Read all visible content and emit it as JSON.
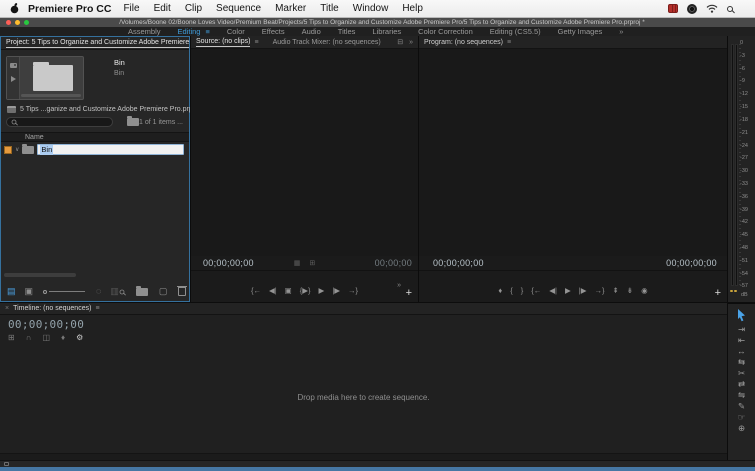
{
  "menu_bar": {
    "app_name": "Premiere Pro CC",
    "items": [
      "File",
      "Edit",
      "Clip",
      "Sequence",
      "Marker",
      "Title",
      "Window",
      "Help"
    ]
  },
  "title_bar": {
    "title": "/Volumes/Boone 02/Boone Loves Video/Premium Beat/Projects/5 Tips to Organize and Customize Adobe Premiere Pro/5 Tips to Organize and Customize Adobe Premiere Pro.prproj *"
  },
  "workspace": {
    "tabs": [
      "Assembly",
      "Editing",
      "Color",
      "Effects",
      "Audio",
      "Titles",
      "Libraries",
      "Color Correction",
      "Editing (CS5.5)",
      "Getty Images"
    ],
    "active_tab": "Editing",
    "menu_glyph": "≡",
    "overflow_glyph": "»"
  },
  "project": {
    "tab": "Project: 5 Tips to Organize and Customize Adobe Premiere",
    "overflow_glyph": "»",
    "item_name": "Bin",
    "item_type": "Bin",
    "file_label": "5 Tips ...ganize and Customize Adobe Premiere Pro.prproj",
    "count_label": "1 of 1 items ...",
    "name_column": "Name",
    "bin_value": "Bin",
    "chevron_glyph": "∨",
    "toolbar": {
      "list_glyph": "▤",
      "icon_glyph": "▣",
      "automate_glyph": "◌",
      "faint_glyph": "▥",
      "item_glyph": "▢"
    }
  },
  "source": {
    "tab": "Source: (no clips)",
    "menu_glyph": "≡",
    "tab2": "Audio Track Mixer: (no sequences)",
    "options_glyph": "⊟",
    "overflow_glyph": "»",
    "timecode": "00;00;00;00",
    "duration": "00;00;00",
    "mid_icons": [
      "▦",
      "⊞"
    ],
    "transport": [
      "{←",
      "◀|",
      "▣",
      "{▶}",
      "▶",
      "|▶",
      "→}"
    ],
    "plus_glyph": "+"
  },
  "program": {
    "tab": "Program: (no sequences)",
    "menu_glyph": "≡",
    "timecode": "00;00;00;00",
    "duration": "00;00;00;00",
    "transport": [
      "♦",
      "{",
      "}",
      "{←",
      "◀|",
      "▶",
      "|▶",
      "→}",
      "⇞",
      "⇟",
      "◉"
    ],
    "plus_glyph": "+"
  },
  "meter": {
    "labels": [
      "0",
      "-3",
      "-6",
      "-9",
      "-12",
      "-15",
      "-18",
      "-21",
      "-24",
      "-27",
      "-30",
      "-33",
      "-36",
      "-39",
      "-42",
      "-45",
      "-48",
      "-51",
      "-54",
      "-57"
    ],
    "unit": "dB"
  },
  "timeline": {
    "close_glyph": "×",
    "tab": "Timeline: (no sequences)",
    "menu_glyph": "≡",
    "timecode": "00;00;00;00",
    "tools": [
      "⊞",
      "∩",
      "◫",
      "♦",
      "⚙"
    ],
    "empty_message": "Drop media here to create sequence."
  },
  "tools": {
    "glyphs": [
      "⇥",
      "⇤",
      "↔",
      "⇆",
      "✂",
      "⇄",
      "⇋",
      "✎",
      "☞",
      "⊕"
    ]
  }
}
